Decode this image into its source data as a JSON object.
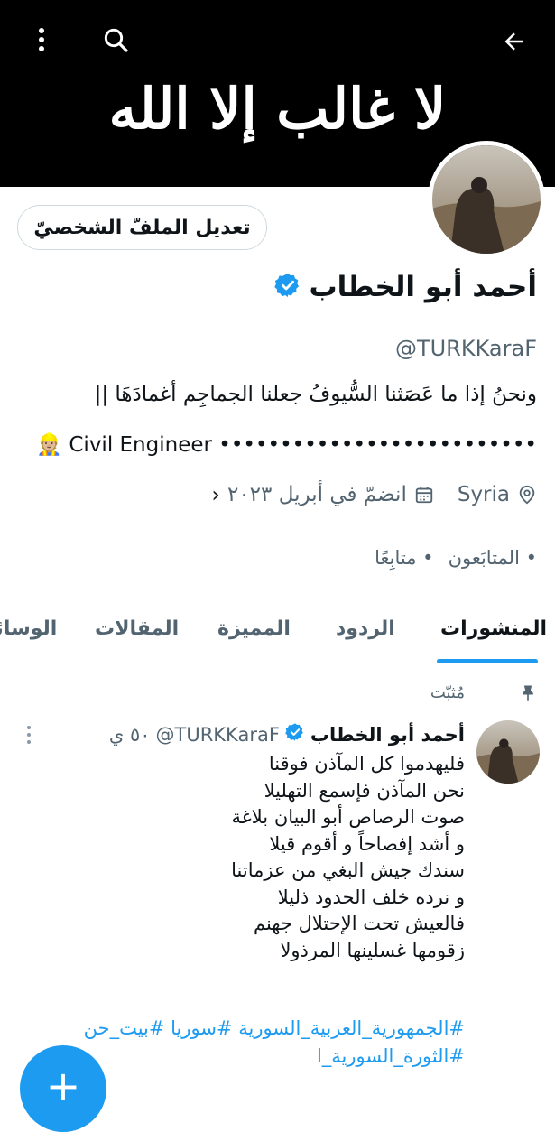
{
  "banner": {
    "text": "لا غالب إلا الله"
  },
  "header": {
    "back_icon": "arrow-left-icon",
    "search_icon": "search-icon",
    "more_icon": "more-vertical-icon"
  },
  "profile": {
    "edit_button": "تعديل الملفّ الشخصيّ",
    "name": "أحمد أبو الخطاب",
    "handle": "@TURKKaraF",
    "bio_line1": "ونحنُ إذا ما عَصَثنا السُّيوفُ جعلنا الجماجِم أغمادَهَا ||",
    "bio_line2": "Civil Engineer ••••••••••••••••••••••••••",
    "bio_emoji": "👷🏼",
    "location": "Syria",
    "joined": "انضمّ في أبريل ٢٠٢٣",
    "following_count": "•",
    "following_label": "متابِعًا",
    "followers_count": "•",
    "followers_label": "المتابَعون",
    "accent_color": "#1d9bf0"
  },
  "tabs": [
    {
      "label": "المنشورات",
      "active": true
    },
    {
      "label": "الردود",
      "active": false
    },
    {
      "label": "المميزة",
      "active": false
    },
    {
      "label": "المقالات",
      "active": false
    },
    {
      "label": "الوسائط",
      "active": false
    }
  ],
  "pinned_tweet": {
    "pinned_label": "مُثبّت",
    "author": "أحمد أبو الخطاب",
    "handle": "@TURKKaraF",
    "time": "٥٠ ي",
    "lines": [
      "فليهدموا كل المآذن فوقنا",
      "نحن المآذن فإسمع التهليلا",
      "صوت الرصاص أبو البيان بلاغة",
      "و أشد إفصاحاً و أقوم قيلا",
      "سندك جيش البغي من عزماتنا",
      "و نرده خلف الحدود ذليلا",
      "فالعيش تحت الإحتلال جهنم",
      "زقومها غسلينها المرذولا"
    ],
    "hashtags_line1": "#الجمهورية_العربية_السورية #سوريا #بيت_حن",
    "hashtags_line2": "#الثورة_السورية_ا"
  },
  "fab": {
    "label": "+"
  }
}
